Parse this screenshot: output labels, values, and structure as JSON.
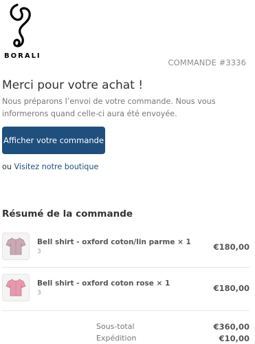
{
  "brand": {
    "name": "BORALI"
  },
  "order": {
    "number_label": "COMMANDE #3336"
  },
  "thanks": {
    "title": "Merci pour votre achat !",
    "message": "Nous préparons l’envoi de votre commande. Nous vous informerons quand celle-ci aura été envoyée."
  },
  "actions": {
    "view_order_label": "Afficher votre commande",
    "or_text": "ou",
    "shop_link_label": "Visitez notre boutique"
  },
  "summary": {
    "title": "Résumé de la commande",
    "items": [
      {
        "name": "Bell shirt - oxford coton/lin parme × 1",
        "qty": "3",
        "price": "€180,00",
        "color": "#c9aab4"
      },
      {
        "name": "Bell shirt - oxford coton rose × 1",
        "qty": "3",
        "price": "€180,00",
        "color": "#e79aae"
      }
    ],
    "subtotal_label": "Sous-total",
    "subtotal_value": "€360,00",
    "shipping_label": "Expédition",
    "shipping_value": "€10,00"
  },
  "colors": {
    "accent": "#1f4f7c",
    "muted": "#777777"
  }
}
